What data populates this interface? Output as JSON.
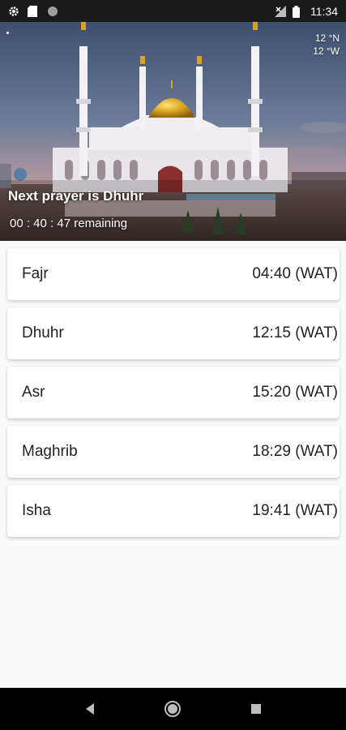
{
  "status_bar": {
    "time": "11:34",
    "icons_left": [
      "gear-icon",
      "sd-card-icon",
      "circle-icon"
    ],
    "icons_right": [
      "signal-icon",
      "battery-icon"
    ]
  },
  "header": {
    "coords_lat": "12 °N",
    "coords_lon": "12 °W",
    "next_prayer": "Next prayer is Dhuhr",
    "remaining": "00 : 40 : 47 remaining"
  },
  "prayers": [
    {
      "name": "Fajr",
      "time": "04:40 (WAT)"
    },
    {
      "name": "Dhuhr",
      "time": "12:15 (WAT)"
    },
    {
      "name": "Asr",
      "time": "15:20 (WAT)"
    },
    {
      "name": "Maghrib",
      "time": "18:29 (WAT)"
    },
    {
      "name": "Isha",
      "time": "19:41 (WAT)"
    }
  ],
  "nav_bar": {
    "icons": [
      "back-icon",
      "home-icon",
      "recents-icon"
    ]
  },
  "colors": {
    "status_bar": "#1a1a1a",
    "card_bg": "#ffffff",
    "nav_bar": "#000000",
    "dome_gold": "#d9a321"
  }
}
